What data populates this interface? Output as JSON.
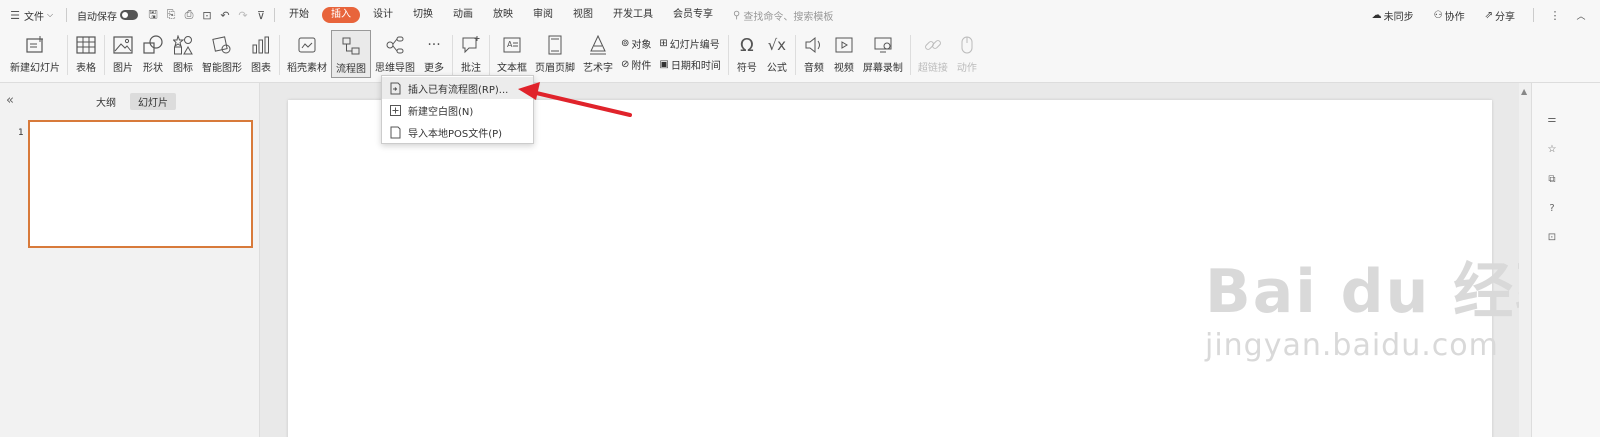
{
  "menubar": {
    "file_label": "文件",
    "autosave_label": "自动保存",
    "tabs": [
      "开始",
      "插入",
      "设计",
      "切换",
      "动画",
      "放映",
      "审阅",
      "视图",
      "开发工具",
      "会员专享"
    ],
    "active_tab": "插入",
    "search_placeholder": "查找命令、搜索模板",
    "sync_label": "未同步",
    "collab_label": "协作",
    "share_label": "分享"
  },
  "ribbon": {
    "new_slide": "新建幻灯片",
    "table": "表格",
    "picture": "图片",
    "shape": "形状",
    "icon": "图标",
    "smartart": "智能图形",
    "chart": "图表",
    "material": "稻壳素材",
    "flowchart": "流程图",
    "mindmap": "思维导图",
    "more": "更多",
    "comment": "批注",
    "textbox": "文本框",
    "header_footer": "页眉页脚",
    "wordart": "艺术字",
    "object": "对象",
    "slide_number": "幻灯片编号",
    "attachment": "附件",
    "datetime": "日期和时间",
    "symbol": "符号",
    "formula": "公式",
    "audio": "音频",
    "video": "视频",
    "screen_record": "屏幕录制",
    "hyperlink": "超链接",
    "action": "动作"
  },
  "dropdown": {
    "items": [
      "插入已有流程图(RP)...",
      "新建空白图(N)",
      "导入本地POS文件(P)"
    ]
  },
  "leftpanel": {
    "tab_outline": "大纲",
    "tab_slides": "幻灯片",
    "slide_number": "1"
  },
  "watermark": {
    "top": "Bai du 经验",
    "bottom": "jingyan.baidu.com"
  },
  "colors": {
    "accent": "#e8643b",
    "thumb_border": "#d87a3a",
    "annotation_arrow": "#e0232b"
  }
}
